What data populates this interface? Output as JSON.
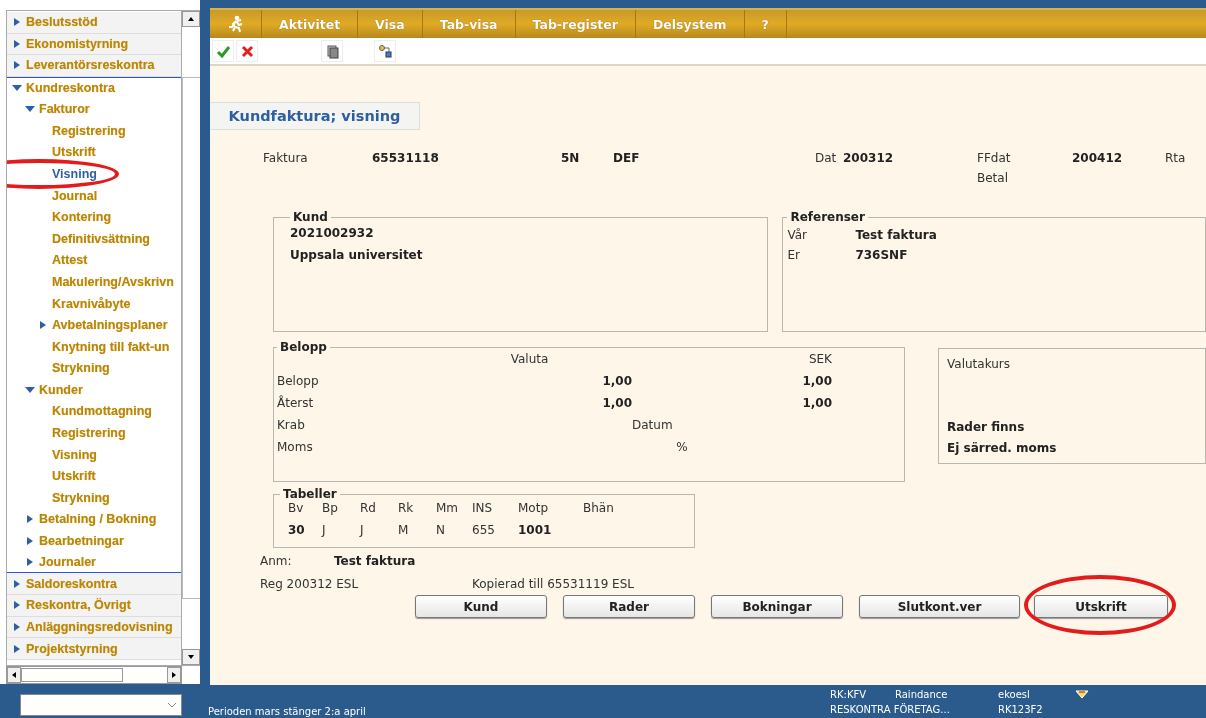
{
  "sidebar": {
    "sections": [
      {
        "label": "Beslutsstöd",
        "expanded": false
      },
      {
        "label": "Ekonomistyrning",
        "expanded": false
      },
      {
        "label": "Leverantörsreskontra",
        "expanded": false
      },
      {
        "label": "Kundreskontra",
        "expanded": true,
        "children": [
          {
            "label": "Fakturor",
            "expanded": true,
            "children": [
              {
                "label": "Registrering",
                "selected": false,
                "circled": false
              },
              {
                "label": "Utskrift",
                "selected": false,
                "circled": false
              },
              {
                "label": "Visning",
                "selected": true,
                "circled": true
              },
              {
                "label": "Journal",
                "selected": false,
                "circled": false
              },
              {
                "label": "Kontering",
                "selected": false,
                "circled": false
              },
              {
                "label": "Definitivsättning",
                "selected": false,
                "circled": false
              },
              {
                "label": "Attest",
                "selected": false,
                "circled": false
              },
              {
                "label": "Makulering/Avskrivn",
                "selected": false,
                "circled": false
              },
              {
                "label": "Kravnivåbyte",
                "selected": false,
                "circled": false
              },
              {
                "label": "Avbetalningsplaner",
                "expanded": false,
                "circled": false
              },
              {
                "label": "Knytning till fakt-un",
                "selected": false,
                "circled": false
              },
              {
                "label": "Strykning",
                "selected": false,
                "circled": false
              }
            ]
          },
          {
            "label": "Kunder",
            "expanded": true,
            "children": [
              {
                "label": "Kundmottagning",
                "selected": false
              },
              {
                "label": "Registrering",
                "selected": false
              },
              {
                "label": "Visning",
                "selected": false
              },
              {
                "label": "Utskrift",
                "selected": false
              },
              {
                "label": "Strykning",
                "selected": false
              }
            ]
          },
          {
            "label": "Betalning / Bokning",
            "expanded": false
          },
          {
            "label": "Bearbetningar",
            "expanded": false
          },
          {
            "label": "Journaler",
            "expanded": false
          }
        ]
      },
      {
        "label": "Saldoreskontra",
        "expanded": false
      },
      {
        "label": "Reskontra, Övrigt",
        "expanded": false
      },
      {
        "label": "Anläggningsredovisning",
        "expanded": false
      },
      {
        "label": "Projektstyrning",
        "expanded": false
      }
    ]
  },
  "menu": [
    "Aktivitet",
    "Visa",
    "Tab-visa",
    "Tab-register",
    "Delsystem",
    "?"
  ],
  "form": {
    "title": "Kundfaktura; visning",
    "header": {
      "invoice_label": "Faktura",
      "invoice_number": "65531118",
      "invoice_code": "5N",
      "invoice_status": "DEF",
      "date_label": "Dat",
      "date": "200312",
      "due_label": "FFdat",
      "due_date": "200412",
      "rta_label": "Rta",
      "betal_label": "Betal"
    },
    "kund": {
      "title": "Kund",
      "lines": [
        "2021002932",
        "Uppsala universitet"
      ]
    },
    "referenser": {
      "title": "Referenser",
      "rows": [
        {
          "label": "Vår",
          "value": "Test faktura"
        },
        {
          "label": "Er",
          "value": "736SNF"
        }
      ]
    },
    "belopp": {
      "title": "Belopp",
      "valuta_header": "Valuta",
      "sek_header": "SEK",
      "rows": [
        {
          "label": "Belopp",
          "valuta": "1,00",
          "sek": "1,00"
        },
        {
          "label": "Återst",
          "valuta": "1,00",
          "sek": "1,00"
        },
        {
          "label": "Krab",
          "note": "Datum"
        },
        {
          "label": "Moms",
          "note": "%"
        }
      ]
    },
    "valutakurs": {
      "label": "Valutakurs",
      "notes": [
        "Rader finns",
        "Ej särred. moms"
      ]
    },
    "tabeller": {
      "title": "Tabeller",
      "columns": [
        "Bv",
        "Bp",
        "Rd",
        "Rk",
        "Mm",
        "INS",
        "Motp",
        "Bhän"
      ],
      "values": [
        {
          "text": "30",
          "bold": true
        },
        {
          "text": "J",
          "bold": false
        },
        {
          "text": "J",
          "bold": false
        },
        {
          "text": "M",
          "bold": false
        },
        {
          "text": "N",
          "bold": false
        },
        {
          "text": "655",
          "bold": false
        },
        {
          "text": "1001",
          "bold": true
        }
      ]
    },
    "anm_label": "Anm:",
    "anm": "Test faktura",
    "reg": "Reg 200312 ESL",
    "copied": "Kopierad till 65531119 ESL",
    "buttons": [
      {
        "label": "Kund",
        "circled": false
      },
      {
        "label": "Rader",
        "circled": false
      },
      {
        "label": "Bokningar",
        "circled": false
      },
      {
        "label": "Slutkont.ver",
        "circled": false
      },
      {
        "label": "Utskrift",
        "circled": true
      }
    ]
  },
  "status_bar": {
    "message": "Perioden mars stänger 2:a april",
    "rk": "RK:KFV",
    "app": "Raindance",
    "user": "ekoesl",
    "ledger": "RESKONTRA FÖRETAG...",
    "code": "RK123F2"
  }
}
